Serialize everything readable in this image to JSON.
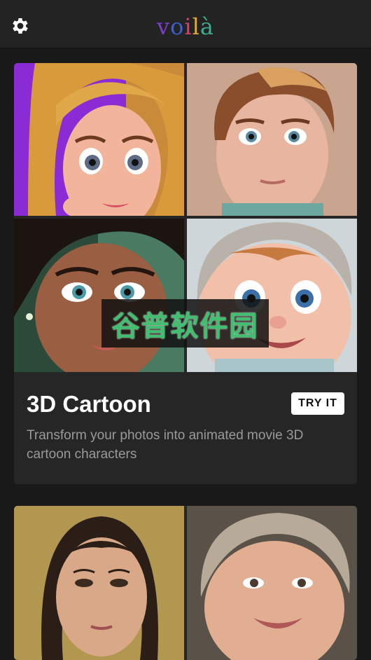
{
  "app": {
    "logo_letters": [
      "v",
      "o",
      "i",
      "l",
      "à"
    ],
    "icons": {
      "settings": "gear-icon"
    },
    "colors": {
      "background": "#191919",
      "card": "#262626",
      "header": "#232323",
      "watermark_text": "#3fbf6f"
    }
  },
  "cards": [
    {
      "title": "3D Cartoon",
      "button_label": "TRY IT",
      "description": "Transform your photos into animated movie 3D cartoon characters",
      "watermark": "谷普软件园",
      "images": [
        "cartoon-girl-blonde",
        "cartoon-boy-brown-hair",
        "cartoon-woman-curly-hair",
        "cartoon-baby-headband"
      ]
    },
    {
      "images": [
        "renaissance-portrait-woman",
        "renaissance-portrait-baby"
      ]
    }
  ]
}
